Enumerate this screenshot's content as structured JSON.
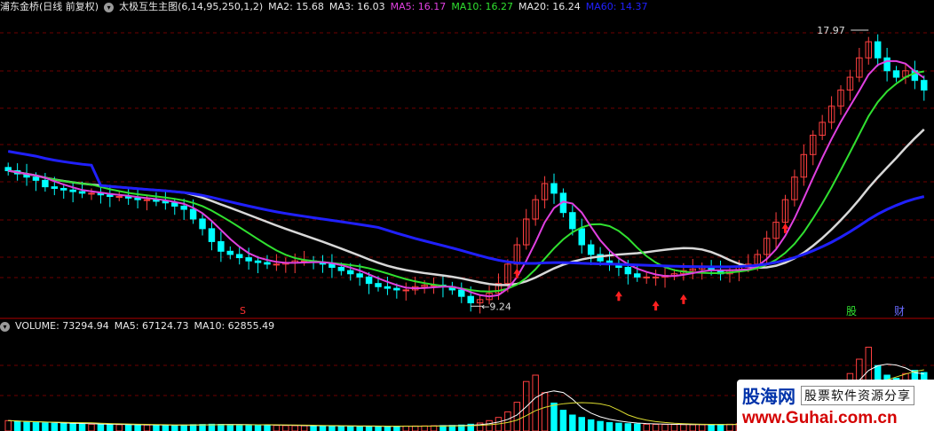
{
  "main_header": {
    "stock_name": "浦东金桥(日线 前复权)",
    "indicator_name": "太极互生主图(6,14,95,250,1,2)",
    "ma_readouts": [
      {
        "label": "MA2: 15.68",
        "color": "#e8e8e8"
      },
      {
        "label": "MA3: 16.03",
        "color": "#e8e8e8"
      },
      {
        "label": "MA5: 16.17",
        "color": "#e040e0"
      },
      {
        "label": "MA10: 16.27",
        "color": "#30e030"
      },
      {
        "label": "MA20: 16.24",
        "color": "#e8e8e8"
      },
      {
        "label": "MA60: 14.37",
        "color": "#2020ff"
      }
    ]
  },
  "volume_header": {
    "label": "VOLUME: 73294.94",
    "ma5": "MA5: 67124.73",
    "ma10": "MA10: 62855.49"
  },
  "annotations": {
    "high_label": "17.97",
    "low_label": "9.24",
    "marker_s": "S",
    "marker_news": "股",
    "marker_fin": "财"
  },
  "watermark": {
    "logo": "股海网",
    "slogan": "股票软件资源分享",
    "url": "www.Guhai.com.cn"
  },
  "colors": {
    "background": "#000000",
    "grid": "#6e0000",
    "up": "#ff4040",
    "down": "#00ffff",
    "ma5": "#e040e0",
    "ma10": "#30e030",
    "ma20": "#d8d8d8",
    "ma60": "#2020ff",
    "arrow_buy": "#ff2020"
  },
  "chart_data": {
    "type": "candlestick",
    "price_range": [
      9.0,
      18.3
    ],
    "high": 17.97,
    "low": 9.24,
    "closes": [
      13.5,
      13.4,
      13.3,
      13.2,
      13.0,
      12.95,
      12.9,
      12.85,
      12.8,
      12.8,
      12.75,
      12.7,
      12.7,
      12.65,
      12.6,
      12.6,
      12.55,
      12.5,
      12.4,
      12.3,
      12.0,
      11.7,
      11.3,
      11.0,
      10.9,
      10.8,
      10.7,
      10.65,
      10.6,
      10.6,
      10.65,
      10.7,
      10.7,
      10.65,
      10.6,
      10.5,
      10.4,
      10.3,
      10.2,
      10.0,
      9.9,
      9.85,
      9.8,
      9.8,
      9.9,
      9.95,
      9.95,
      9.9,
      9.8,
      9.6,
      9.4,
      9.5,
      9.7,
      10.0,
      10.6,
      11.2,
      12.0,
      12.6,
      13.1,
      12.8,
      12.2,
      11.7,
      11.2,
      10.9,
      10.7,
      10.6,
      10.5,
      10.3,
      10.2,
      10.2,
      10.2,
      10.25,
      10.3,
      10.4,
      10.45,
      10.5,
      10.4,
      10.3,
      10.4,
      10.5,
      10.6,
      10.9,
      11.4,
      11.9,
      12.6,
      13.3,
      14.0,
      14.6,
      15.0,
      15.5,
      16.0,
      16.4,
      17.0,
      17.5,
      17.0,
      16.6,
      16.4,
      16.6,
      16.3,
      16.0
    ],
    "volumes": [
      13000,
      12000,
      11000,
      10500,
      10000,
      9800,
      9500,
      9000,
      8800,
      8500,
      8200,
      8000,
      7900,
      7800,
      7600,
      7500,
      7300,
      7200,
      7000,
      7500,
      8000,
      8200,
      8500,
      8300,
      8000,
      7800,
      7600,
      7400,
      7200,
      7000,
      6800,
      6700,
      6600,
      6500,
      6400,
      6300,
      6200,
      6000,
      5900,
      5800,
      5800,
      5900,
      6000,
      6200,
      6300,
      6400,
      6600,
      6800,
      7000,
      7500,
      8500,
      10000,
      13000,
      17000,
      24000,
      36000,
      62000,
      70000,
      48000,
      35000,
      26000,
      20000,
      17000,
      14000,
      12000,
      10500,
      9800,
      9200,
      8800,
      8500,
      8300,
      8200,
      8100,
      8000,
      7900,
      7900,
      8000,
      8200,
      8500,
      9200,
      10500,
      12000,
      14500,
      17500,
      21000,
      25000,
      30000,
      36000,
      44000,
      52000,
      60000,
      72000,
      90000,
      105000,
      82000,
      70000,
      66000,
      72000,
      76000,
      73294.94
    ],
    "volume_range": [
      0,
      120000
    ],
    "ma60_visible_from_index": 0
  }
}
